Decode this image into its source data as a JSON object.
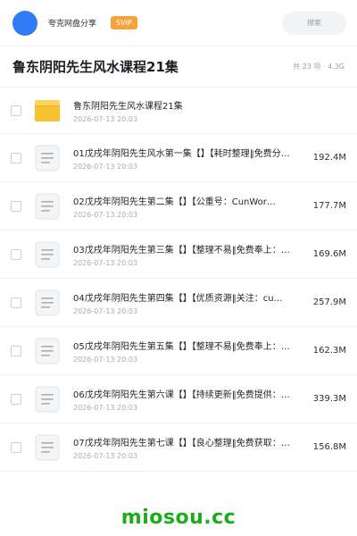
{
  "header": {
    "user_name": "夸克网盘分享",
    "badge": "SVIP",
    "search_placeholder": "搜索",
    "avatar_color": "#2f7cf6"
  },
  "title": {
    "text": "鲁东阴阳先生风水课程21集",
    "summary": "共 23 项 · 4.3G"
  },
  "files": [
    {
      "type": "folder-icon",
      "name": "鲁东阴阳先生风水课程21集",
      "date": "2026-07-13 20:03",
      "size": ""
    },
    {
      "type": "document-icon",
      "name": "01戊戌年阴阳先生风水第一集【】【耗时整理‖免费分…",
      "date": "2026-07-13 20:03",
      "size": "192.4M"
    },
    {
      "type": "document-icon",
      "name": "02戊戌年阴阳先生第二集【】【公重号：CunWor…",
      "date": "2026-07-13 20:03",
      "size": "177.7M"
    },
    {
      "type": "document-icon",
      "name": "03戊戌年阴阳先生第三集【】【整理不易‖免费奉上：…",
      "date": "2026-07-13 20:03",
      "size": "169.6M"
    },
    {
      "type": "document-icon",
      "name": "04戊戌年阴阳先生第四集【】【优质资源‖关注：cu…",
      "date": "2026-07-13 20:03",
      "size": "257.9M"
    },
    {
      "type": "document-icon",
      "name": "05戊戌年阴阳先生第五集【】【整理不易‖免费奉上：…",
      "date": "2026-07-13 20:03",
      "size": "162.3M"
    },
    {
      "type": "document-icon",
      "name": "06戊戌年阴阳先生第六课【】【持续更新‖免费提供：…",
      "date": "2026-07-13 20:03",
      "size": "339.3M"
    },
    {
      "type": "document-icon",
      "name": "07戊戌年阴阳先生第七课【】【良心整理‖免费获取：…",
      "date": "2026-07-13 20:03",
      "size": "156.8M"
    }
  ],
  "footer": {
    "brand": "miosou.cc",
    "brand_color": "#1aad19"
  }
}
